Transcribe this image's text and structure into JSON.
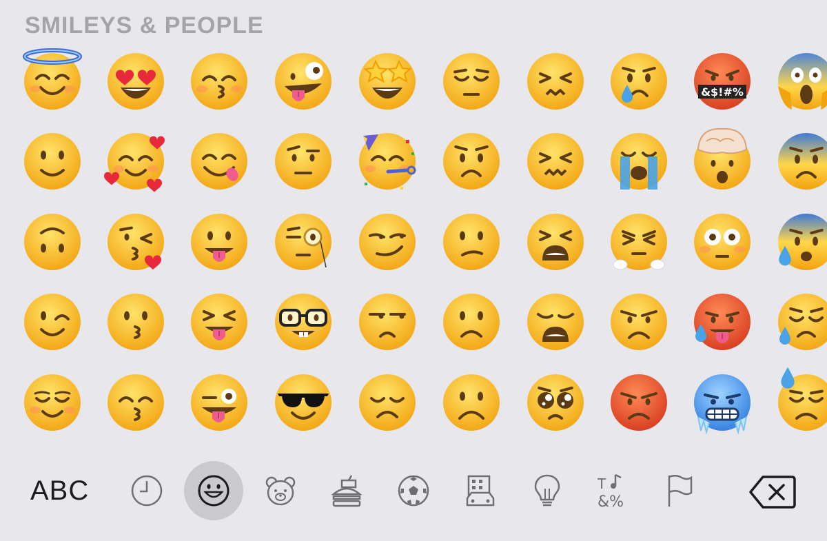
{
  "section_title": "SMILEYS & PEOPLE",
  "emoji_rows": [
    [
      "smiling-face-with-halo",
      "smiling-face-with-heart-eyes",
      "kissing-face-with-smiling-eyes",
      "zany-face",
      "star-struck",
      "pensive-face",
      "confounded-face",
      "crying-face",
      "face-with-symbols-on-mouth",
      "face-screaming-in-fear"
    ],
    [
      "slightly-smiling-face",
      "smiling-face-with-hearts",
      "face-savoring-food",
      "face-with-raised-eyebrow",
      "partying-face",
      "worried-face",
      "persevering-face",
      "loudly-crying-face",
      "exploding-head",
      "anxious-face-with-sweat"
    ],
    [
      "upside-down-face",
      "face-blowing-a-kiss",
      "face-with-tongue",
      "face-with-monocle",
      "smirking-face",
      "confused-face",
      "tired-face",
      "face-with-steam-from-nose",
      "flushed-face",
      "face-with-sweat"
    ],
    [
      "winking-face",
      "kissing-face",
      "squinting-face-with-tongue",
      "nerd-face",
      "unamused-face",
      "slightly-frowning-face",
      "weary-face",
      "angry-face",
      "hot-face",
      "sad-but-relieved-face"
    ],
    [
      "relieved-face",
      "kissing-face-with-closed-eyes",
      "winking-face-with-tongue",
      "smiling-face-with-sunglasses",
      "disappointed-face",
      "frowning-face",
      "pleading-face",
      "pouting-face",
      "cold-face",
      "downcast-face-with-sweat"
    ]
  ],
  "symbols_text": "&$!#%",
  "keyboard": {
    "abc_label": "ABC",
    "categories": [
      "recent-clock",
      "smileys",
      "animals",
      "food",
      "activity",
      "travel",
      "objects",
      "symbols",
      "flags"
    ],
    "selected_category": "smileys"
  },
  "colors": {
    "background": "#e8e8ec",
    "title": "#a3a3a8",
    "face_yellow": "#fdc02f",
    "face_red": "#e04a2a",
    "face_cold": "#3f8be0",
    "icon_gray": "#6e6e73",
    "selected_bg": "#c9c9ce"
  }
}
